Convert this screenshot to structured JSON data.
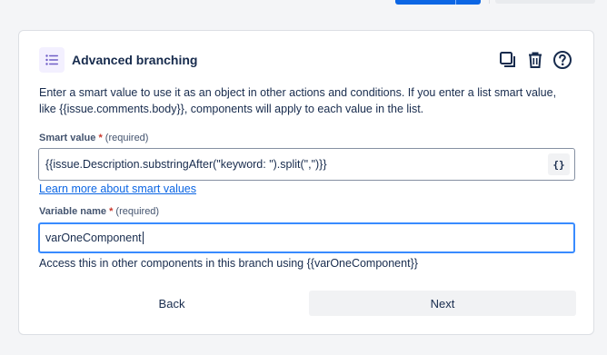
{
  "card": {
    "title": "Advanced branching",
    "description": "Enter a smart value to use it as an object in other actions and conditions. If you enter a list smart value, like {{issue.comments.body}}, components will apply to each value in the list.",
    "tools": [
      "duplicate-icon",
      "trash-icon",
      "help-icon"
    ]
  },
  "smart_value": {
    "label": "Smart value",
    "required_mark": "*",
    "required_hint": "(required)",
    "value": "{{issue.Description.substringAfter(\"keyword: \").split(\",\")}}",
    "brace_button_label": "{}",
    "learn_more": "Learn more about smart values"
  },
  "variable_name": {
    "label": "Variable name",
    "required_mark": "*",
    "required_hint": "(required)",
    "value": "varOneComponent",
    "helper": "Access this in other components in this branch using {{varOneComponent}}"
  },
  "buttons": {
    "back": "Back",
    "next": "Next"
  },
  "colors": {
    "accent": "#0c66e4",
    "focus": "#388bff",
    "required": "#c9372c",
    "icon_bg": "#f3f0ff",
    "icon": "#6e5dc6"
  }
}
